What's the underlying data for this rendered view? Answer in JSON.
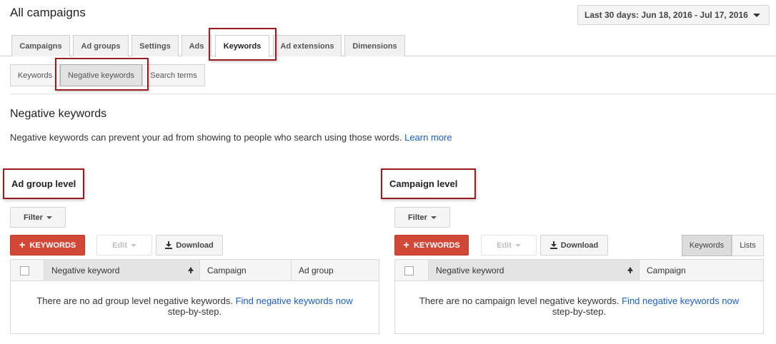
{
  "header": {
    "title": "All campaigns",
    "date_range": "Last 30 days: Jun 18, 2016 - Jul 17, 2016"
  },
  "tabs": [
    "Campaigns",
    "Ad groups",
    "Settings",
    "Ads",
    "Keywords",
    "Ad extensions",
    "Dimensions"
  ],
  "active_tab": "Keywords",
  "subtabs": [
    "Keywords",
    "Negative keywords",
    "Search terms"
  ],
  "active_subtab": "Negative keywords",
  "page": {
    "heading": "Negative keywords",
    "description": "Negative keywords can prevent your ad from showing to people who search using those words.",
    "learn_more": "Learn more"
  },
  "ad_group_section": {
    "title": "Ad group level",
    "filter_label": "Filter",
    "add_label": "KEYWORDS",
    "edit_label": "Edit",
    "download_label": "Download",
    "columns": [
      "Negative keyword",
      "Campaign",
      "Ad group"
    ],
    "empty_text": "There are no ad group level negative keywords.",
    "empty_link": "Find negative keywords now",
    "empty_tail": "step-by-step."
  },
  "campaign_section": {
    "title": "Campaign level",
    "filter_label": "Filter",
    "add_label": "KEYWORDS",
    "edit_label": "Edit",
    "download_label": "Download",
    "view_toggle": [
      "Keywords",
      "Lists"
    ],
    "columns": [
      "Negative keyword",
      "Campaign"
    ],
    "empty_text": "There are no campaign level negative keywords.",
    "empty_link": "Find negative keywords now",
    "empty_tail": "step-by-step."
  },
  "colors": {
    "accent_red": "#d14836",
    "highlight_border": "#9b1c20",
    "link": "#1a5dbf"
  }
}
